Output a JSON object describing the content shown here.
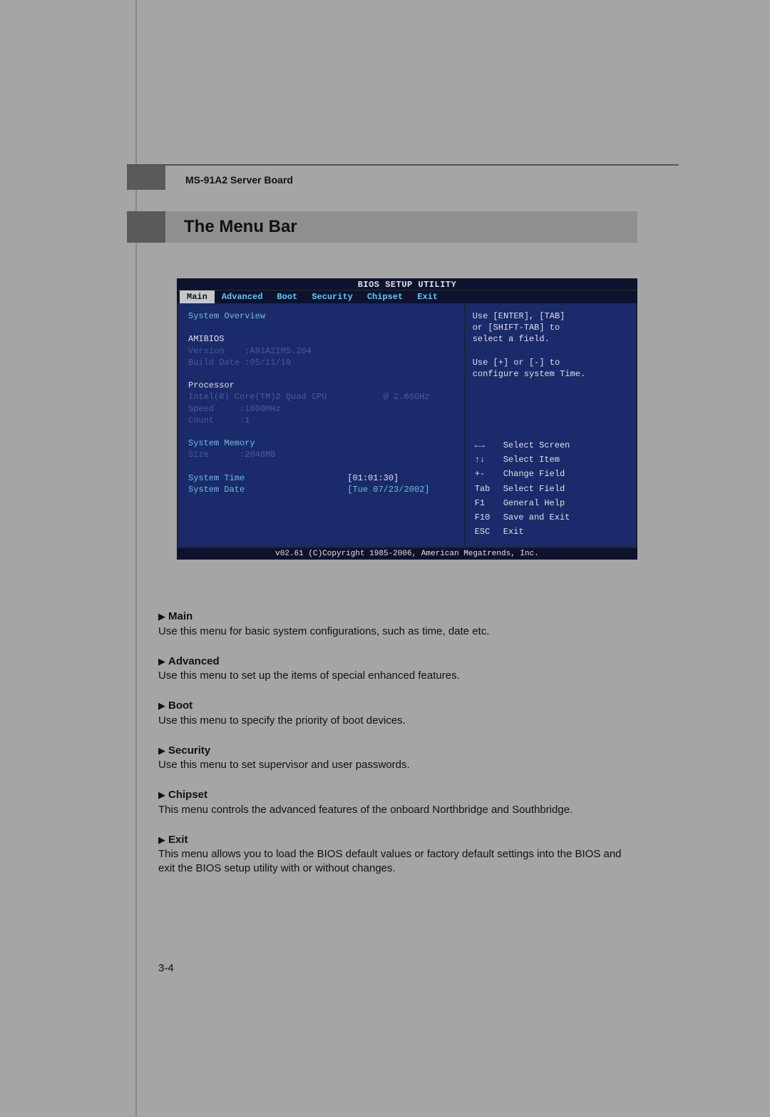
{
  "header": {
    "board": "MS-91A2 Server Board",
    "section_title": "The Menu Bar"
  },
  "bios": {
    "title": "BIOS SETUP UTILITY",
    "tabs": [
      "Main",
      "Advanced",
      "Boot",
      "Security",
      "Chipset",
      "Exit"
    ],
    "main": {
      "overview": "System Overview",
      "amibios_label": "AMIBIOS",
      "version_label": "Version",
      "version_value": ":A91A2IMS.204",
      "build_label": "Build Date",
      "build_value": ":05/11/10",
      "processor_label": "Processor",
      "cpu_name": "Intel(R) Core(TM)2 Quad CPU",
      "cpu_freq": "@ 2.66GHz",
      "speed_label": "Speed",
      "speed_value": ":1600MHz",
      "count_label": "Count",
      "count_value": ":1",
      "memory_label": "System Memory",
      "size_label": "Size",
      "size_value": ":2048MB",
      "time_label": "System Time",
      "time_value": "[01:01:30]",
      "date_label": "System Date",
      "date_value": "[Tue 07/23/2002]"
    },
    "help": {
      "line1": "Use [ENTER], [TAB]",
      "line2": "or [SHIFT-TAB] to",
      "line3": "select a field.",
      "blank": "",
      "line4": "Use [+] or [-] to",
      "line5": "configure system Time."
    },
    "nav": [
      {
        "key": "←→",
        "label": "Select Screen"
      },
      {
        "key": "↑↓",
        "label": "Select Item"
      },
      {
        "key": "+-",
        "label": "Change Field"
      },
      {
        "key": "Tab",
        "label": "Select Field"
      },
      {
        "key": "F1",
        "label": "General Help"
      },
      {
        "key": "F10",
        "label": "Save and Exit"
      },
      {
        "key": "ESC",
        "label": "Exit"
      }
    ],
    "footer": "v02.61 (C)Copyright 1985-2006, American Megatrends, Inc."
  },
  "descriptions": [
    {
      "title": "Main",
      "text": "Use this menu for basic system configurations, such as time, date etc."
    },
    {
      "title": "Advanced",
      "text": "Use this menu to set up the items of special enhanced features."
    },
    {
      "title": "Boot",
      "text": "Use this menu to specify the priority of boot devices."
    },
    {
      "title": "Security",
      "text": "Use this menu to set supervisor and user passwords."
    },
    {
      "title": "Chipset",
      "text": "This menu controls the advanced features of the onboard Northbridge and Southbridge."
    },
    {
      "title": "Exit",
      "text": "This menu allows you to load the BIOS default values or factory default settings into the BIOS and exit the BIOS setup utility with or without changes."
    }
  ],
  "page_number": "3-4"
}
